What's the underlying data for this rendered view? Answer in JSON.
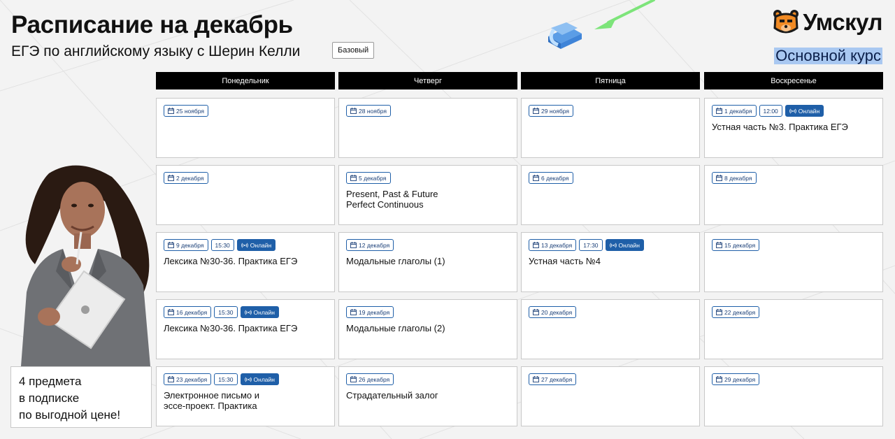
{
  "header": {
    "title": "Расписание на декабрь",
    "subtitle": "ЕГЭ по английскому языку с Шерин Келли",
    "level_tag": "Базовый",
    "brand": "Умскул",
    "course": "Основной курс"
  },
  "colors": {
    "chip_blue": "#1f5fa8",
    "header_black": "#000000",
    "course_highlight": "#a9c8f1",
    "arrow_green": "#7de47a"
  },
  "days": [
    "Понедельник",
    "Четверг",
    "Пятница",
    "Воскресенье"
  ],
  "schedule": [
    [
      {
        "date": "25 ноября"
      },
      {
        "date": "2 декабря"
      },
      {
        "date": "9 декабря",
        "time": "15:30",
        "online": "Онлайн",
        "lesson": "Лексика №30-36. Практика ЕГЭ"
      },
      {
        "date": "16 декабря",
        "time": "15:30",
        "online": "Онлайн",
        "lesson": "Лексика №30-36. Практика ЕГЭ"
      },
      {
        "date": "23 декабря",
        "time": "15:30",
        "online": "Онлайн",
        "lesson": "Электронное письмо и эссе-проект. Практика"
      }
    ],
    [
      {
        "date": "28 ноября"
      },
      {
        "date": "5 декабря",
        "lesson": "Present, Past & Future Perfect Continuous"
      },
      {
        "date": "12 декабря",
        "lesson": "Модальные глаголы (1)"
      },
      {
        "date": "19 декабря",
        "lesson": "Модальные глаголы (2)"
      },
      {
        "date": "26 декабря",
        "lesson": "Страдательный залог"
      }
    ],
    [
      {
        "date": "29 ноября"
      },
      {
        "date": "6 декабря"
      },
      {
        "date": "13 декабря",
        "time": "17:30",
        "online": "Онлайн",
        "lesson": "Устная часть №4"
      },
      {
        "date": "20 декабря"
      },
      {
        "date": "27 декабря"
      }
    ],
    [
      {
        "date": "1 декабря",
        "time": "12:00",
        "online": "Онлайн",
        "lesson": "Устная часть №3. Практика ЕГЭ"
      },
      {
        "date": "8 декабря"
      },
      {
        "date": "15 декабря"
      },
      {
        "date": "22 декабря"
      },
      {
        "date": "29 декабря"
      }
    ]
  ],
  "promo": {
    "line1": "4 предмета",
    "line2": "в подписке",
    "line3": "по выгодной цене!"
  },
  "icons": {
    "date": "calendar-icon",
    "online": "broadcast-icon",
    "brand": "bear-logo",
    "decor": "3d-stack-icon",
    "pointer": "green-arrow-icon"
  }
}
